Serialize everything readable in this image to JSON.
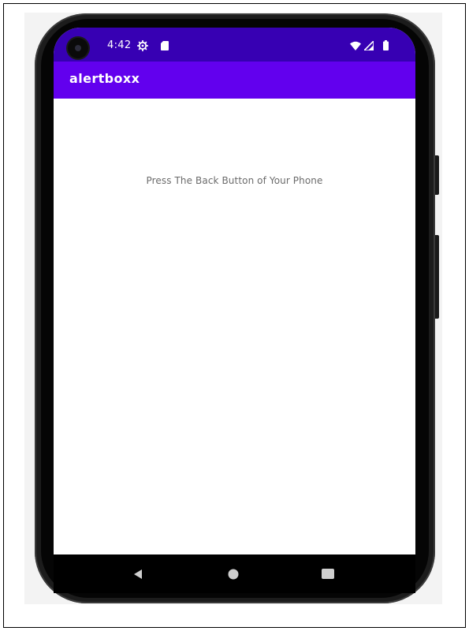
{
  "status_bar": {
    "time": "4:42",
    "icons": [
      "gear-icon",
      "sd-card-icon",
      "wifi-icon",
      "signal-icon",
      "battery-icon"
    ],
    "background_color": "#3700b3"
  },
  "app_bar": {
    "title": "alertboxx",
    "background_color": "#6200ee"
  },
  "content": {
    "message": "Press The Back Button of Your Phone"
  },
  "nav_bar": {
    "buttons": [
      "back-icon",
      "home-icon",
      "recents-icon"
    ]
  }
}
